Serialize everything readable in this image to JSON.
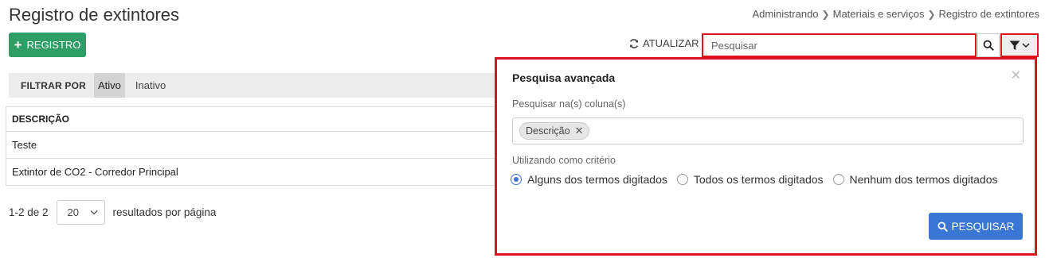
{
  "page": {
    "title": "Registro de extintores",
    "breadcrumb": [
      "Administrando",
      "Materiais e serviços",
      "Registro de extintores"
    ]
  },
  "toolbar": {
    "new_label": "REGISTRO",
    "refresh_label": "ATUALIZAR",
    "search_placeholder": "Pesquisar"
  },
  "filter": {
    "label": "FILTRAR POR",
    "options": [
      {
        "label": "Ativo",
        "active": true
      },
      {
        "label": "Inativo",
        "active": false
      }
    ]
  },
  "table": {
    "header": "DESCRIÇÃO",
    "rows": [
      "Teste",
      "Extintor de CO2 - Corredor Principal"
    ]
  },
  "pagination": {
    "range": "1-2 de 2",
    "page_size": "20",
    "per_page_label": "resultados por página"
  },
  "advanced_search": {
    "title": "Pesquisa avançada",
    "columns_label": "Pesquisar na(s) coluna(s)",
    "selected_columns": [
      "Descrição"
    ],
    "criteria_label": "Utilizando como critério",
    "criteria": [
      {
        "label": "Alguns dos termos digitados",
        "checked": true
      },
      {
        "label": "Todos os termos digitados",
        "checked": false
      },
      {
        "label": "Nenhum dos termos digitados",
        "checked": false
      }
    ],
    "submit_label": "PESQUISAR"
  },
  "colors": {
    "primary_green": "#2e9e66",
    "primary_blue": "#3a77d4",
    "highlight_red": "#e0121e"
  }
}
